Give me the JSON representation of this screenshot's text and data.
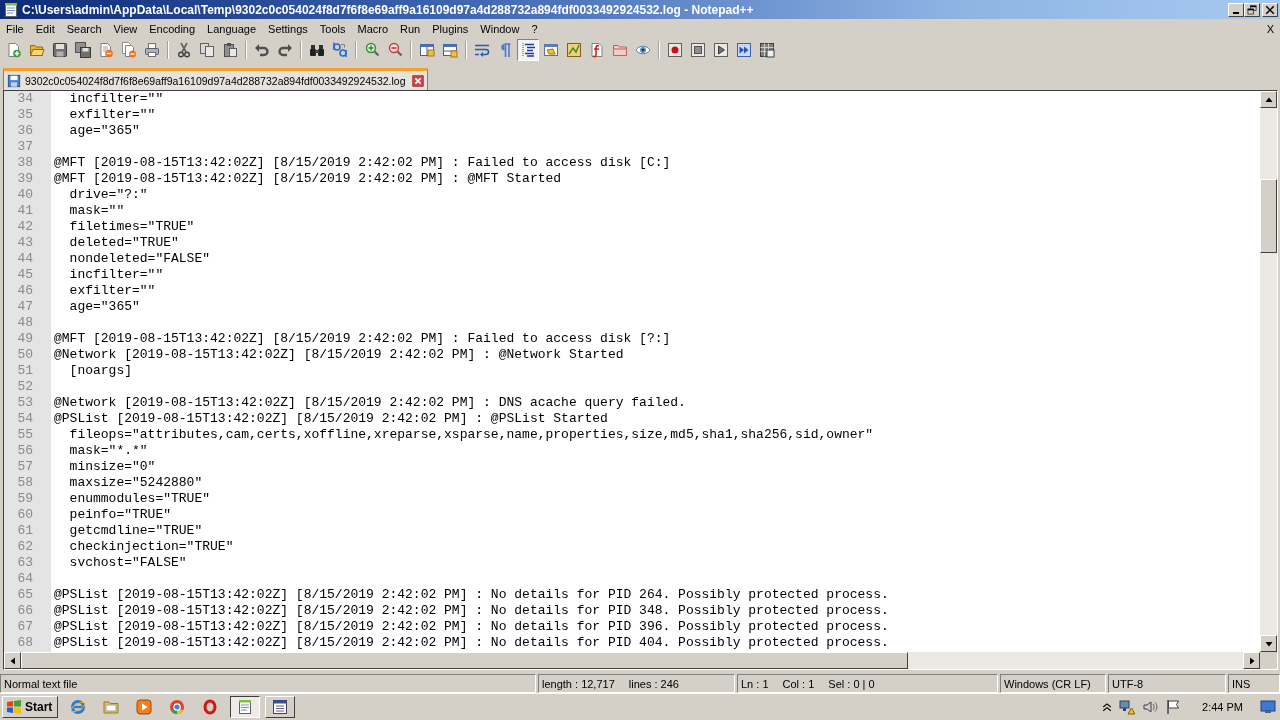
{
  "window": {
    "title": "C:\\Users\\admin\\AppData\\Local\\Temp\\9302c0c054024f8d7f6f8e69aff9a16109d97a4d288732a894fdf0033492924532.log - Notepad++"
  },
  "menu": {
    "items": [
      "File",
      "Edit",
      "Search",
      "View",
      "Encoding",
      "Language",
      "Settings",
      "Tools",
      "Macro",
      "Run",
      "Plugins",
      "Window",
      "?"
    ],
    "close_label": "X"
  },
  "toolbar": [
    [
      {
        "kind": "new",
        "pressed": false
      },
      {
        "kind": "open",
        "pressed": false
      },
      {
        "kind": "save",
        "pressed": false
      },
      {
        "kind": "saveall",
        "pressed": false
      },
      {
        "kind": "close",
        "pressed": false
      },
      {
        "kind": "closeall",
        "pressed": false
      },
      {
        "kind": "print",
        "pressed": false
      }
    ],
    [
      {
        "kind": "cut",
        "pressed": false
      },
      {
        "kind": "copy",
        "pressed": false
      },
      {
        "kind": "paste",
        "pressed": false
      }
    ],
    [
      {
        "kind": "undo",
        "pressed": false
      },
      {
        "kind": "redo",
        "pressed": false
      }
    ],
    [
      {
        "kind": "find",
        "pressed": false
      },
      {
        "kind": "replace",
        "pressed": false
      }
    ],
    [
      {
        "kind": "zoomin",
        "pressed": false
      },
      {
        "kind": "zoomout",
        "pressed": false
      }
    ],
    [
      {
        "kind": "syncv",
        "pressed": false
      },
      {
        "kind": "synch",
        "pressed": false
      }
    ],
    [
      {
        "kind": "wrap",
        "pressed": false
      },
      {
        "kind": "allchars",
        "pressed": false
      },
      {
        "kind": "indent",
        "pressed": true
      },
      {
        "kind": "udl",
        "pressed": false
      },
      {
        "kind": "docmap",
        "pressed": false
      },
      {
        "kind": "funclist",
        "pressed": false
      },
      {
        "kind": "workspace",
        "pressed": false
      },
      {
        "kind": "monitor",
        "pressed": false
      }
    ],
    [
      {
        "kind": "record",
        "pressed": false
      },
      {
        "kind": "stop",
        "pressed": false
      },
      {
        "kind": "play",
        "pressed": false
      },
      {
        "kind": "playmulti",
        "pressed": false
      },
      {
        "kind": "savemacro",
        "pressed": false
      }
    ]
  ],
  "tabs": [
    {
      "label": "9302c0c054024f8d7f6f8e69aff9a16109d97a4d288732a894fdf0033492924532.log",
      "selected": true
    }
  ],
  "editor": {
    "lines": [
      {
        "number": "34",
        "text": "  incfilter=\"\""
      },
      {
        "number": "35",
        "text": "  exfilter=\"\""
      },
      {
        "number": "36",
        "text": "  age=\"365\""
      },
      {
        "number": "37"
      },
      {
        "number": "38",
        "text": "@MFT [2019-08-15T13:42:02Z] [8/15/2019 2:42:02 PM] : Failed to access disk [C:]"
      },
      {
        "number": "39",
        "text": "@MFT [2019-08-15T13:42:02Z] [8/15/2019 2:42:02 PM] : @MFT Started"
      },
      {
        "number": "40",
        "text": "  drive=\"?:\""
      },
      {
        "number": "41",
        "text": "  mask=\"\""
      },
      {
        "number": "42",
        "text": "  filetimes=\"TRUE\""
      },
      {
        "number": "43",
        "text": "  deleted=\"TRUE\""
      },
      {
        "number": "44",
        "text": "  nondeleted=\"FALSE\""
      },
      {
        "number": "45",
        "text": "  incfilter=\"\""
      },
      {
        "number": "46",
        "text": "  exfilter=\"\""
      },
      {
        "number": "47",
        "text": "  age=\"365\""
      },
      {
        "number": "48"
      },
      {
        "number": "49",
        "text": "@MFT [2019-08-15T13:42:02Z] [8/15/2019 2:42:02 PM] : Failed to access disk [?:]"
      },
      {
        "number": "50",
        "text": "@Network [2019-08-15T13:42:02Z] [8/15/2019 2:42:02 PM] : @Network Started"
      },
      {
        "number": "51",
        "text": "  [noargs]"
      },
      {
        "number": "52"
      },
      {
        "number": "53",
        "text": "@Network [2019-08-15T13:42:02Z] [8/15/2019 2:42:02 PM] : DNS acache query failed."
      },
      {
        "number": "54",
        "text": "@PSList [2019-08-15T13:42:02Z] [8/15/2019 2:42:02 PM] : @PSList Started"
      },
      {
        "number": "55",
        "text": "  fileops=\"attributes,cam,certs,xoffline,xreparse,xsparse,name,properties,size,md5,sha1,sha256,sid,owner\""
      },
      {
        "number": "56",
        "text": "  mask=\"*.*\""
      },
      {
        "number": "57",
        "text": "  minsize=\"0\""
      },
      {
        "number": "58",
        "text": "  maxsize=\"5242880\""
      },
      {
        "number": "59",
        "text": "  enummodules=\"TRUE\""
      },
      {
        "number": "60",
        "text": "  peinfo=\"TRUE\""
      },
      {
        "number": "61",
        "text": "  getcmdline=\"TRUE\""
      },
      {
        "number": "62",
        "text": "  checkinjection=\"TRUE\""
      },
      {
        "number": "63",
        "text": "  svchost=\"FALSE\""
      },
      {
        "number": "64"
      },
      {
        "number": "65",
        "text": "@PSList [2019-08-15T13:42:02Z] [8/15/2019 2:42:02 PM] : No details for PID 264. Possibly protected process."
      },
      {
        "number": "66",
        "text": "@PSList [2019-08-15T13:42:02Z] [8/15/2019 2:42:02 PM] : No details for PID 348. Possibly protected process."
      },
      {
        "number": "67",
        "text": "@PSList [2019-08-15T13:42:02Z] [8/15/2019 2:42:02 PM] : No details for PID 396. Possibly protected process."
      },
      {
        "number": "68",
        "text": "@PSList [2019-08-15T13:42:02Z] [8/15/2019 2:42:02 PM] : No details for PID 404. Possibly protected process."
      }
    ]
  },
  "status_bar": [
    [
      "Normal text file"
    ],
    [
      "length : 12,717",
      "lines : 246"
    ],
    [
      "Ln : 1",
      "Col : 1",
      "Sel : 0 | 0"
    ],
    [
      "Windows (CR LF)"
    ],
    [
      "UTF-8"
    ],
    [
      "INS"
    ]
  ],
  "taskbar": {
    "start_label": "Start",
    "quick_launch": [
      {
        "kind": "ie"
      },
      {
        "kind": "explorer"
      },
      {
        "kind": "media"
      },
      {
        "kind": "chrome"
      },
      {
        "kind": "opera"
      }
    ],
    "tasks": [
      {
        "kind": "notepad",
        "selected": true
      },
      {
        "kind": "window",
        "selected": false
      }
    ],
    "clock": "2:44 PM"
  }
}
